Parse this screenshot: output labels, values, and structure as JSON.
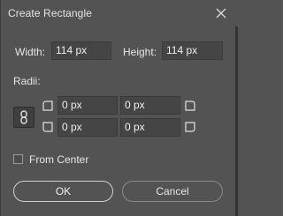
{
  "window": {
    "title": "Create Rectangle",
    "close_icon": "close-icon"
  },
  "size": {
    "width_label": "Width:",
    "width_value": "114 px",
    "height_label": "Height:",
    "height_value": "114 px"
  },
  "radii": {
    "label": "Radii:",
    "link_icon": "chain-link-icon",
    "top_left": "0 px",
    "top_right": "0 px",
    "bottom_left": "0 px",
    "bottom_right": "0 px"
  },
  "options": {
    "from_center_label": "From Center",
    "from_center_checked": false
  },
  "buttons": {
    "ok": "OK",
    "cancel": "Cancel"
  }
}
